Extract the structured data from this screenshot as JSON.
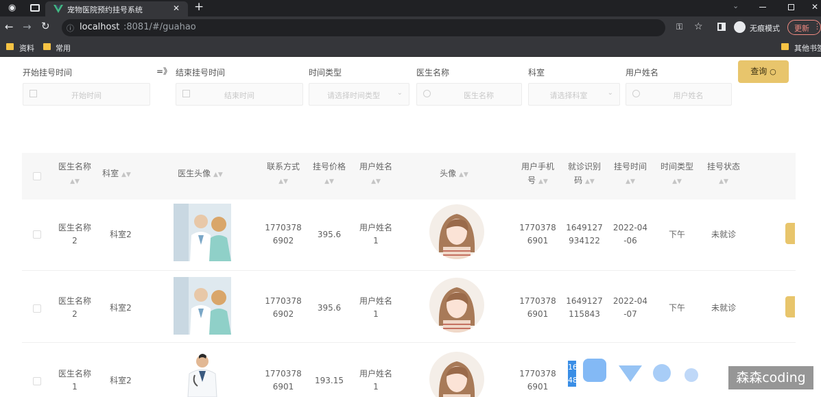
{
  "browser": {
    "tab_title": "宠物医院预约挂号系统",
    "close": "✕",
    "new_tab": "+",
    "url_host": "localhost",
    "url_rest": ":8081/#/guahao",
    "incognito_label": "无痕模式",
    "update_label": "更新",
    "bookmarks": [
      "资料",
      "常用"
    ],
    "other_bookmarks": "其他书签"
  },
  "filters": {
    "start_label": "开始挂号时间",
    "arrow": "=》",
    "end_label": "结束挂号时间",
    "time_type_label": "时间类型",
    "doctor_label": "医生名称",
    "dept_label": "科室",
    "user_label": "用户姓名",
    "start_placeholder": "开始时间",
    "end_placeholder": "结束时间",
    "time_type_placeholder": "请选择时间类型",
    "doctor_placeholder": "医生名称",
    "dept_placeholder": "请选择科室",
    "user_placeholder": "用户姓名",
    "query_label": "查询"
  },
  "columns": {
    "doctor_name": [
      "医生名称"
    ],
    "dept": "科室",
    "doctor_avatar": "医生头像",
    "contact": [
      "联系方式"
    ],
    "price": [
      "挂号价格"
    ],
    "user_name": [
      "用户姓名"
    ],
    "avatar": "头像",
    "user_phone": [
      "用户手机",
      "号"
    ],
    "code": [
      "就诊识别",
      "码"
    ],
    "reg_time": [
      "挂号时间"
    ],
    "time_type": [
      "时间类型"
    ],
    "status": [
      "挂号状态"
    ]
  },
  "rows": [
    {
      "doctor": [
        "医生名称",
        "2"
      ],
      "dept": "科室2",
      "contact": [
        "1770378",
        "6902"
      ],
      "price": "395.6",
      "user": [
        "用户姓名",
        "1"
      ],
      "phone": [
        "1770378",
        "6901"
      ],
      "code": [
        "1649127",
        "934122"
      ],
      "time": [
        "2022-04",
        "-06"
      ],
      "type": "下午",
      "status": "未就诊"
    },
    {
      "doctor": [
        "医生名称",
        "2"
      ],
      "dept": "科室2",
      "contact": [
        "1770378",
        "6902"
      ],
      "price": "395.6",
      "user": [
        "用户姓名",
        "1"
      ],
      "phone": [
        "1770378",
        "6901"
      ],
      "code": [
        "1649127",
        "115843"
      ],
      "time": [
        "2022-04",
        "-07"
      ],
      "type": "下午",
      "status": "未就诊"
    },
    {
      "doctor": [
        "医生名称",
        "1"
      ],
      "dept": "科室2",
      "contact": [
        "1770378",
        "6901"
      ],
      "price": "193.15",
      "user": [
        "用户姓名",
        "1"
      ],
      "phone": [
        "1770378",
        "6901"
      ],
      "code": [
        "16",
        "48"
      ],
      "time": [
        "",
        ""
      ],
      "type": "",
      "status": ""
    }
  ],
  "watermark": "森森coding",
  "colors": {
    "accent": "#e8c56c",
    "chrome_dark": "#202124",
    "chrome": "#35363a"
  }
}
